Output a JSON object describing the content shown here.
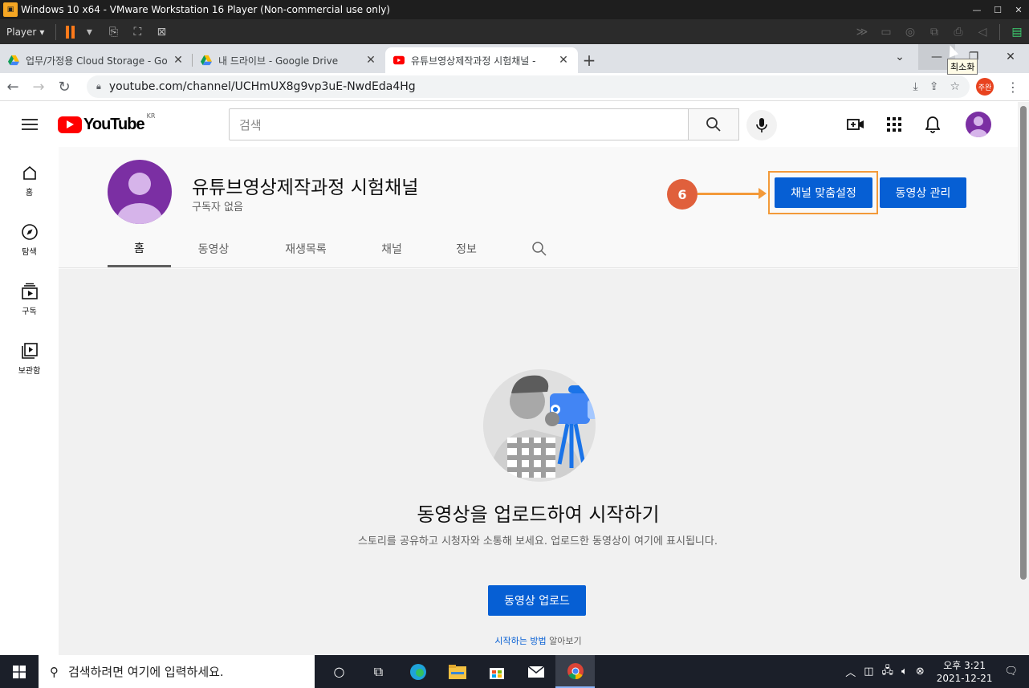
{
  "vm": {
    "title": "Windows 10 x64 - VMware Workstation 16 Player (Non-commercial use only)",
    "player_label": "Player"
  },
  "browser": {
    "tabs": [
      {
        "label": "업무/가정용 Cloud Storage - Go",
        "icon": "google-drive-icon"
      },
      {
        "label": "내 드라이브 - Google Drive",
        "icon": "google-drive-icon"
      },
      {
        "label": "유튜브영상제작과정 시험채널 -",
        "icon": "youtube-icon"
      }
    ],
    "url": "youtube.com/channel/UCHmUX8g9vp3uE-NwdEda4Hg",
    "profile_label": "주완",
    "tooltip": "최소화"
  },
  "youtube": {
    "logo_text": "YouTube",
    "region": "KR",
    "search_placeholder": "검색",
    "sidebar": [
      {
        "label": "홈",
        "icon": "home-icon"
      },
      {
        "label": "탐색",
        "icon": "compass-icon"
      },
      {
        "label": "구독",
        "icon": "subscriptions-icon"
      },
      {
        "label": "보관함",
        "icon": "library-icon"
      }
    ]
  },
  "channel": {
    "name": "유튜브영상제작과정 시험채널",
    "subscribers": "구독자 없음",
    "customize_label": "채널 맞춤설정",
    "manage_label": "동영상 관리",
    "callout_number": "6",
    "tabs": [
      "홈",
      "동영상",
      "재생목록",
      "채널",
      "정보"
    ]
  },
  "empty_state": {
    "title": "동영상을 업로드하여 시작하기",
    "desc": "스토리를 공유하고 시청자와 소통해 보세요. 업로드한 동영상이 여기에 표시됩니다.",
    "upload_label": "동영상 업로드",
    "learn_link": "시작하는 방법",
    "learn_suffix": " 알아보기"
  },
  "taskbar": {
    "search_placeholder": "검색하려면 여기에 입력하세요.",
    "time": "오후 3:21",
    "date": "2021-12-21"
  },
  "colors": {
    "accent": "#065fd4",
    "callout": "#e0603c",
    "highlight": "#f39a3a"
  }
}
